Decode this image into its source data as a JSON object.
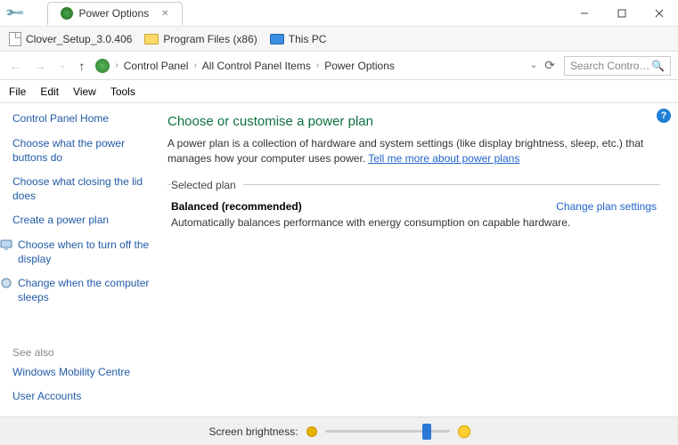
{
  "titlebar": {
    "tab_title": "Power Options"
  },
  "shortcuts": [
    {
      "label": "Clover_Setup_3.0.406",
      "icon": "file"
    },
    {
      "label": "Program Files (x86)",
      "icon": "folder"
    },
    {
      "label": "This PC",
      "icon": "pc"
    }
  ],
  "breadcrumb": {
    "items": [
      "Control Panel",
      "All Control Panel Items",
      "Power Options"
    ]
  },
  "search": {
    "placeholder": "Search Contro…"
  },
  "menu": [
    "File",
    "Edit",
    "View",
    "Tools"
  ],
  "sidebar": {
    "home": "Control Panel Home",
    "links": [
      "Choose what the power buttons do",
      "Choose what closing the lid does",
      "Create a power plan",
      "Choose when to turn off the display",
      "Change when the computer sleeps"
    ],
    "see_also_hdr": "See also",
    "see_also": [
      "Windows Mobility Centre",
      "User Accounts"
    ]
  },
  "main": {
    "title": "Choose or customise a power plan",
    "desc_pre": "A power plan is a collection of hardware and system settings (like display brightness, sleep, etc.) that manages how your computer uses power. ",
    "desc_link": "Tell me more about power plans",
    "fieldset_legend": "Selected plan",
    "plan_name": "Balanced (recommended)",
    "plan_link": "Change plan settings",
    "plan_desc": "Automatically balances performance with energy consumption on capable hardware."
  },
  "bottom": {
    "label": "Screen brightness:"
  }
}
